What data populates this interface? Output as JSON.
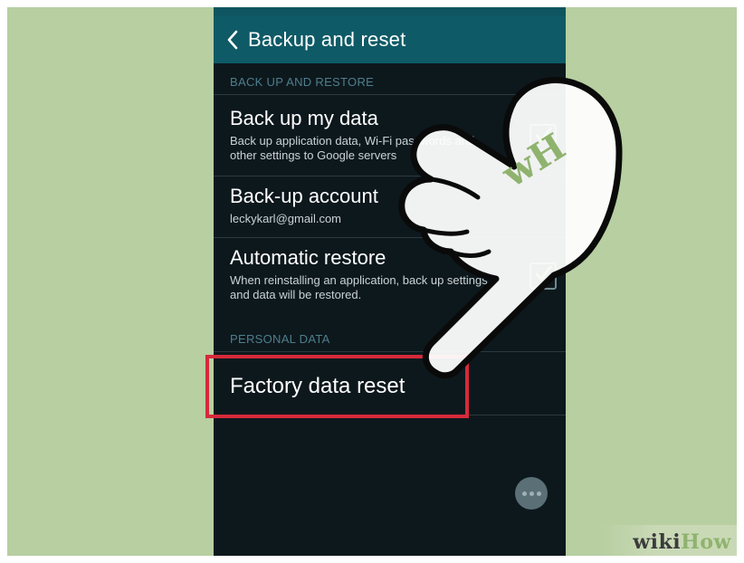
{
  "action_bar": {
    "title": "Backup and reset"
  },
  "sections": {
    "backup_restore": "BACK UP AND RESTORE",
    "personal_data": "PERSONAL DATA"
  },
  "items": [
    {
      "title": "Back up my data",
      "subtitle": "Back up application data, Wi-Fi passwords and other settings to Google servers",
      "checked": true
    },
    {
      "title": "Back-up account",
      "subtitle": "leckykarl@gmail.com"
    },
    {
      "title": "Automatic restore",
      "subtitle": "When reinstalling an application, back up settings and data will be restored.",
      "checked": true
    }
  ],
  "reset": {
    "title": "Factory data reset"
  },
  "overlay": {
    "hand_logo": "wH"
  },
  "watermark": {
    "wiki": "wiki",
    "how": "How"
  },
  "colors": {
    "action_bar": "#0e5a66",
    "highlight": "#d62a3a",
    "background": "#b7cfa1",
    "screen": "#0d181d"
  }
}
